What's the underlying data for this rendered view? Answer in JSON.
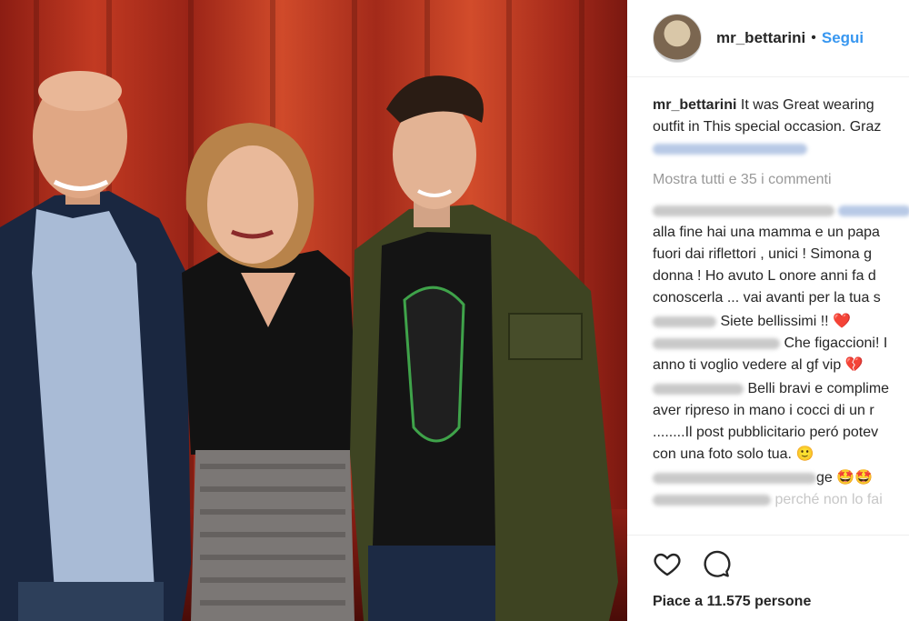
{
  "post": {
    "username": "mr_bettarini",
    "follow": "Segui",
    "caption_line1": "It was Great wearing",
    "caption_line2": "outfit in This special occasion. Graz",
    "view_all": "Mostra tutti e 35 i commenti",
    "comments": [
      {
        "lines": [
          "alla fine hai una mamma e un papa",
          "fuori dai riflettori , unici ! Simona g",
          "donna ! Ho avuto L onore anni fa d",
          "conoscerla ... vai avanti per la tua s"
        ]
      },
      {
        "text": "Siete bellissimi !!"
      },
      {
        "lines": [
          "Che figaccioni! I",
          "anno ti voglio vedere al gf vip"
        ]
      },
      {
        "lines": [
          "Belli bravi e complime",
          "aver ripreso in mano i cocci di un r",
          "........Il post pubblicitario peró potev",
          "con una foto solo tua."
        ]
      },
      {
        "text": "ge"
      },
      {
        "text": "perché non lo fai"
      }
    ],
    "likes": "Piace a 11.575 persone",
    "emoji": {
      "heart": "❤️",
      "heart_broken": "💔",
      "smile": "🙂",
      "star_eyes": "🤩🤩"
    }
  }
}
